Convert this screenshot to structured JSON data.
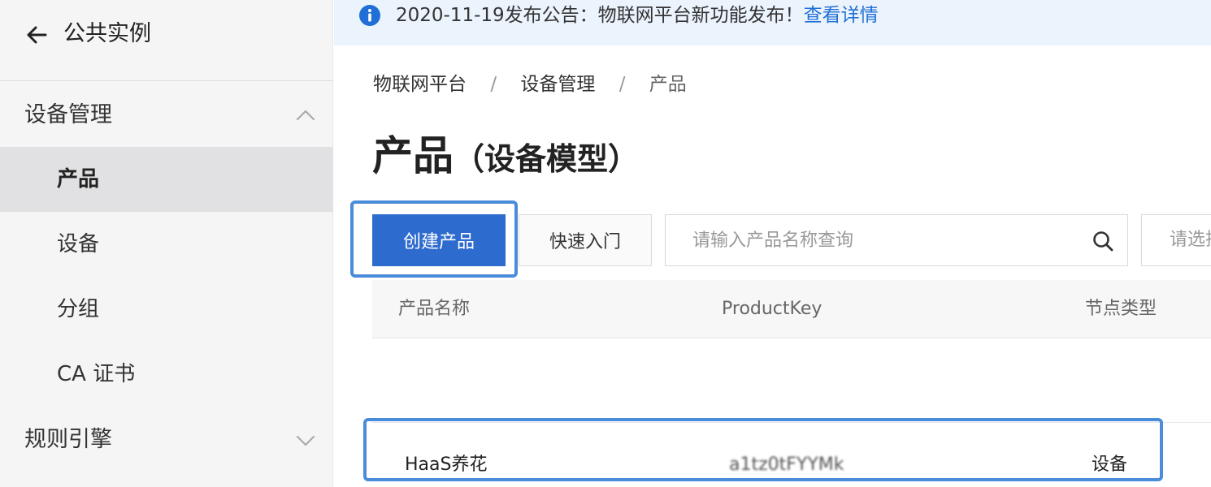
{
  "sidebar": {
    "header": {
      "title": "公共实例",
      "back_icon": "arrow-left-icon"
    },
    "groups": [
      {
        "label": "设备管理",
        "expanded": true
      },
      {
        "label": "规则引擎",
        "expanded": false
      }
    ],
    "items": [
      {
        "label": "产品",
        "active": true
      },
      {
        "label": "设备",
        "active": false
      },
      {
        "label": "分组",
        "active": false
      },
      {
        "label": "CA 证书",
        "active": false
      }
    ]
  },
  "notice": {
    "text": "2020-11-19发布公告：物联网平台新功能发布！",
    "link": "查看详情",
    "icon": "info-icon",
    "color": "#1f6fd6"
  },
  "breadcrumb": [
    "物联网平台",
    "设备管理",
    "产品"
  ],
  "page": {
    "title": "产品",
    "subtitle": "（设备模型）"
  },
  "toolbar": {
    "create_label": "创建产品",
    "quick_label": "快速入门",
    "search_placeholder": "请输入产品名称查询",
    "select_placeholder": "请选择"
  },
  "table": {
    "headers": [
      "产品名称",
      "ProductKey",
      "节点类型"
    ],
    "rows": [
      {
        "name": "HaaS养花",
        "product_key": "a1tz0tFYYMk",
        "node_type": "设备"
      }
    ]
  },
  "colors": {
    "primary": "#2e6bcf",
    "highlight": "#4a8cd9",
    "notice_bg": "#ebf3fd"
  }
}
